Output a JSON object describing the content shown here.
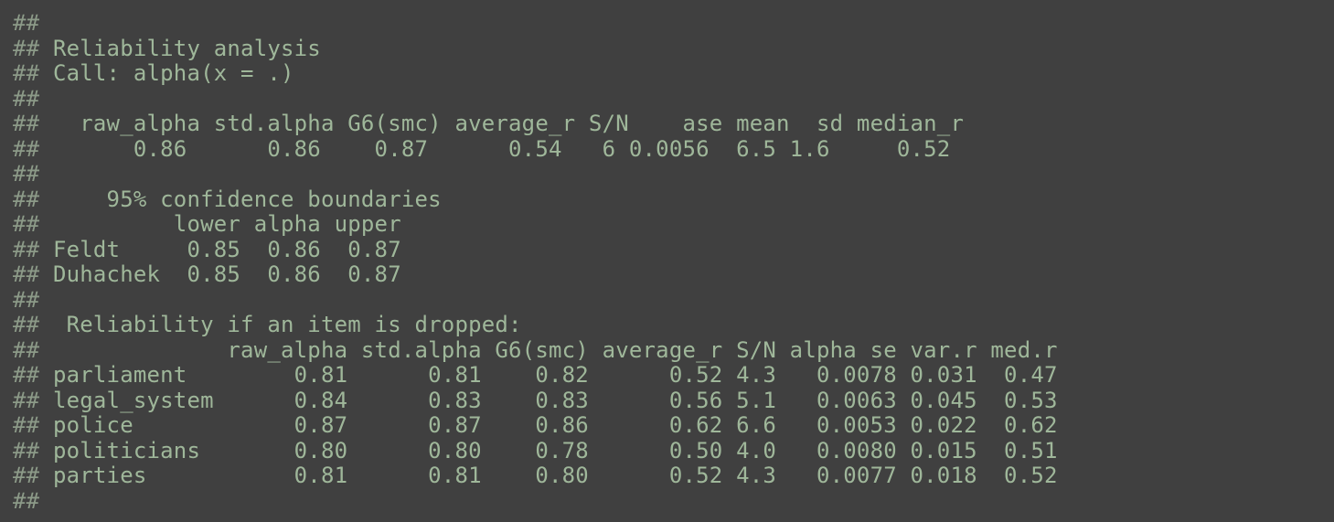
{
  "console": {
    "prefix": "##",
    "lines": [
      "",
      " Reliability analysis",
      " Call: alpha(x = .)",
      "",
      "   raw_alpha std.alpha G6(smc) average_r S/N    ase mean  sd median_r",
      "       0.86      0.86    0.87      0.54   6 0.0056  6.5 1.6     0.52",
      "",
      "     95% confidence boundaries",
      "          lower alpha upper",
      " Feldt     0.85  0.86  0.87",
      " Duhachek  0.85  0.86  0.87",
      "",
      "  Reliability if an item is dropped:",
      "              raw_alpha std.alpha G6(smc) average_r S/N alpha se var.r med.r",
      " parliament        0.81      0.81    0.82      0.52 4.3   0.0078 0.031  0.47",
      " legal_system      0.84      0.83    0.83      0.56 5.1   0.0063 0.045  0.53",
      " police            0.87      0.87    0.86      0.62 6.6   0.0053 0.022  0.62",
      " politicians       0.80      0.80    0.78      0.50 4.0   0.0080 0.015  0.51",
      " parties           0.81      0.81    0.80      0.52 4.3   0.0077 0.018  0.52",
      ""
    ]
  }
}
